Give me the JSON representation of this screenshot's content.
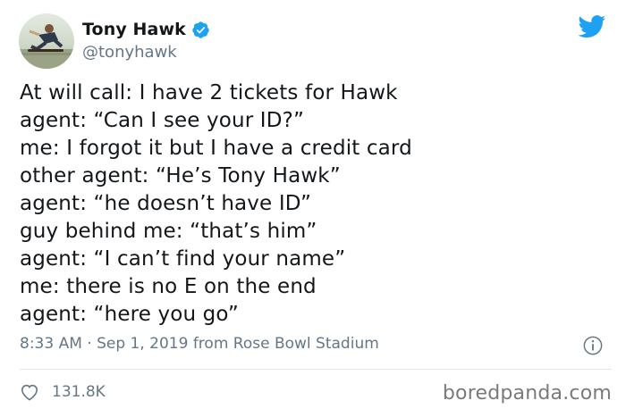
{
  "author": {
    "display_name": "Tony Hawk",
    "handle": "@tonyhawk",
    "verified": true,
    "avatar_icon": "skateboarder-photo"
  },
  "tweet": {
    "lines": [
      "At will call: I have 2 tickets for Hawk",
      "agent: “Can I see your ID?”",
      "me: I forgot it but I have a credit card",
      "other agent: “He’s Tony Hawk”",
      "agent: “he doesn’t have ID”",
      "guy behind me: “that’s him”",
      "agent: “I can’t find your name”",
      "me: there is no E on the end",
      "agent: “here you go”"
    ],
    "meta": "8:33 AM · Sep 1, 2019 from Rose Bowl Stadium"
  },
  "engagement": {
    "likes": "131.8K"
  },
  "watermark": "boredpanda.com",
  "colors": {
    "twitter_blue": "#1da1f2",
    "secondary_text": "#657786"
  }
}
